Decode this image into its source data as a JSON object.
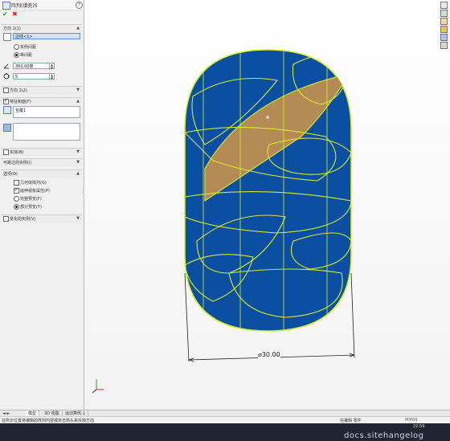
{
  "panel": {
    "title": "阵列(填充)5",
    "help": "?",
    "ok": "✔",
    "cancel": "✖",
    "direction1": {
      "label": "方向 1(1)",
      "edge_field": "边线<1>",
      "options": [
        "实例间距",
        "等间距"
      ],
      "selected_option": 1,
      "angle": "360.00度",
      "count": "5"
    },
    "direction2": {
      "label": "方向 2(2)"
    },
    "features": {
      "label": "特征和面(F)",
      "feature_item": "包覆1"
    },
    "bodies": {
      "label": "实体(B)"
    },
    "instances_to_skip": {
      "label": "可跳过的实例(I)"
    },
    "options": {
      "label": "选项(O)",
      "items": [
        "几何体阵列(G)",
        "延伸视象属性(P)",
        "完整预览(F)",
        "部分预览(T)"
      ]
    },
    "vary": {
      "label": "变化的实例(V)"
    }
  },
  "viewport": {
    "dimension": "⌀30.00",
    "toolbar_icons": [
      "view-orientation-icon",
      "display-style-icon",
      "section-view-icon",
      "appearance-icon",
      "scene-icon",
      "view-settings-icon"
    ]
  },
  "tabs": [
    "模型",
    "3D 视图",
    "运动算例 1"
  ],
  "status": {
    "message": "在所示位置将编辑的阵列内容或单击箭头来反转方向",
    "mode": "在编辑 零件",
    "units": "MMGS",
    "clock": "22:59"
  },
  "watermark": "docs.sitehangelog"
}
